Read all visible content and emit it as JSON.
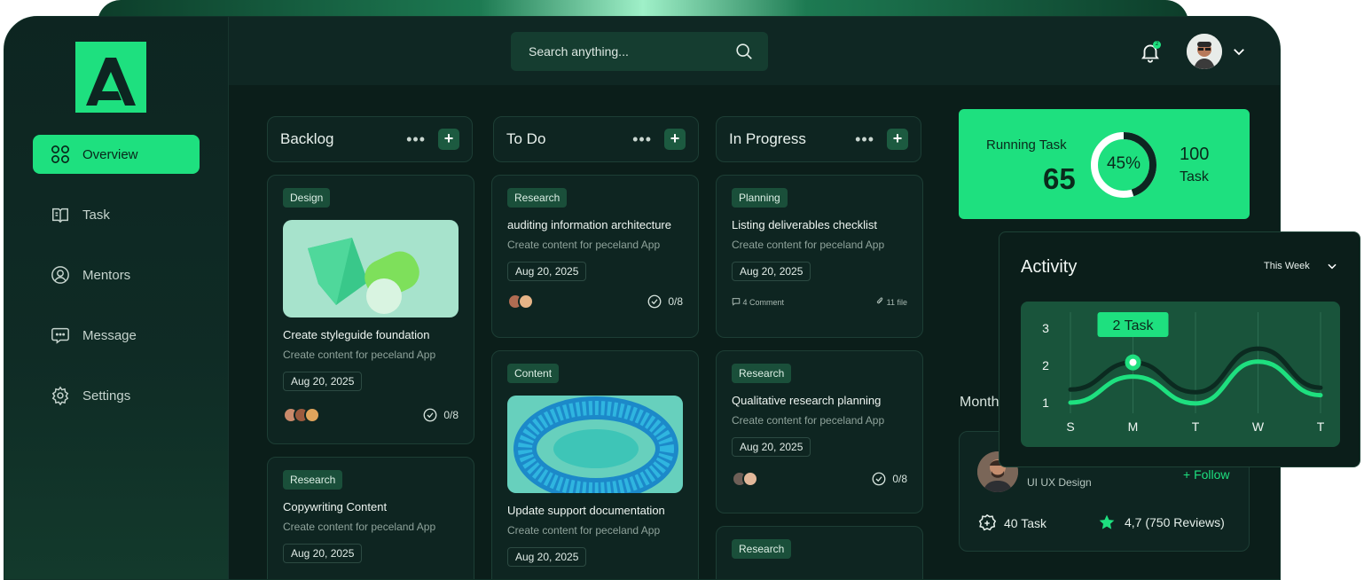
{
  "colors": {
    "accent": "#1ee07f",
    "background": "#0b1e1a",
    "panel": "#0e2521",
    "tag": "#1a4f3a"
  },
  "sidebar": {
    "logo": "logo-icon",
    "items": [
      {
        "label": "Overview",
        "icon": "grid-icon",
        "active": true
      },
      {
        "label": "Task",
        "icon": "book-icon",
        "active": false
      },
      {
        "label": "Mentors",
        "icon": "user-circle-icon",
        "active": false
      },
      {
        "label": "Message",
        "icon": "message-icon",
        "active": false
      },
      {
        "label": "Settings",
        "icon": "gear-icon",
        "active": false
      }
    ]
  },
  "topbar": {
    "search_placeholder": "Search anything...",
    "notification_count": "2"
  },
  "columns": [
    {
      "title": "Backlog"
    },
    {
      "title": "To Do"
    },
    {
      "title": "In Progress"
    }
  ],
  "cards": {
    "backlog_1": {
      "tag": "Design",
      "title": "Create styleguide foundation",
      "subtitle": "Create content for peceland App",
      "date": "Aug 20, 2025",
      "progress": "0/8"
    },
    "backlog_2": {
      "tag": "Research",
      "title": "Copywriting Content",
      "subtitle": "Create content for peceland App",
      "date": "Aug 20, 2025"
    },
    "todo_1": {
      "tag": "Research",
      "title": "auditing information architecture",
      "subtitle": "Create content for peceland App",
      "date": "Aug 20, 2025",
      "progress": "0/8"
    },
    "todo_2": {
      "tag": "Content",
      "title": "Update support documentation",
      "subtitle": "Create content for peceland App",
      "date": "Aug 20, 2025"
    },
    "progress_1": {
      "tag": "Planning",
      "title": "Listing deliverables checklist",
      "subtitle": "Create content for peceland App",
      "date": "Aug 20, 2025",
      "comments": "4 Comment",
      "files": "11 file"
    },
    "progress_2": {
      "tag": "Research",
      "title": "Qualitative research planning",
      "subtitle": "Create content for peceland App",
      "date": "Aug 20, 2025",
      "progress": "0/8"
    },
    "progress_3": {
      "tag": "Research"
    }
  },
  "running_task": {
    "label": "Running Task",
    "value": "65",
    "percent": "45%",
    "percent_value": 0.45,
    "total": "100",
    "total_label": "Task"
  },
  "mentors": {
    "section_label": "Month",
    "role": "UI UX Design",
    "follow": "+ Follow",
    "tasks": "40 Task",
    "rating": "4,7 (750 Reviews)"
  },
  "activity": {
    "title": "Activity",
    "period": "This Week",
    "tooltip": "2 Task",
    "chart_data": {
      "type": "line",
      "x": [
        "S",
        "M",
        "T",
        "W",
        "T"
      ],
      "yticks": [
        "1",
        "2",
        "3"
      ],
      "ylim": [
        1,
        3
      ],
      "series": [
        {
          "values": [
            1.35,
            2.08,
            1.28,
            2.45,
            1.4
          ]
        },
        {
          "values": [
            1.0,
            1.7,
            0.98,
            2.1,
            1.2
          ]
        }
      ]
    }
  }
}
